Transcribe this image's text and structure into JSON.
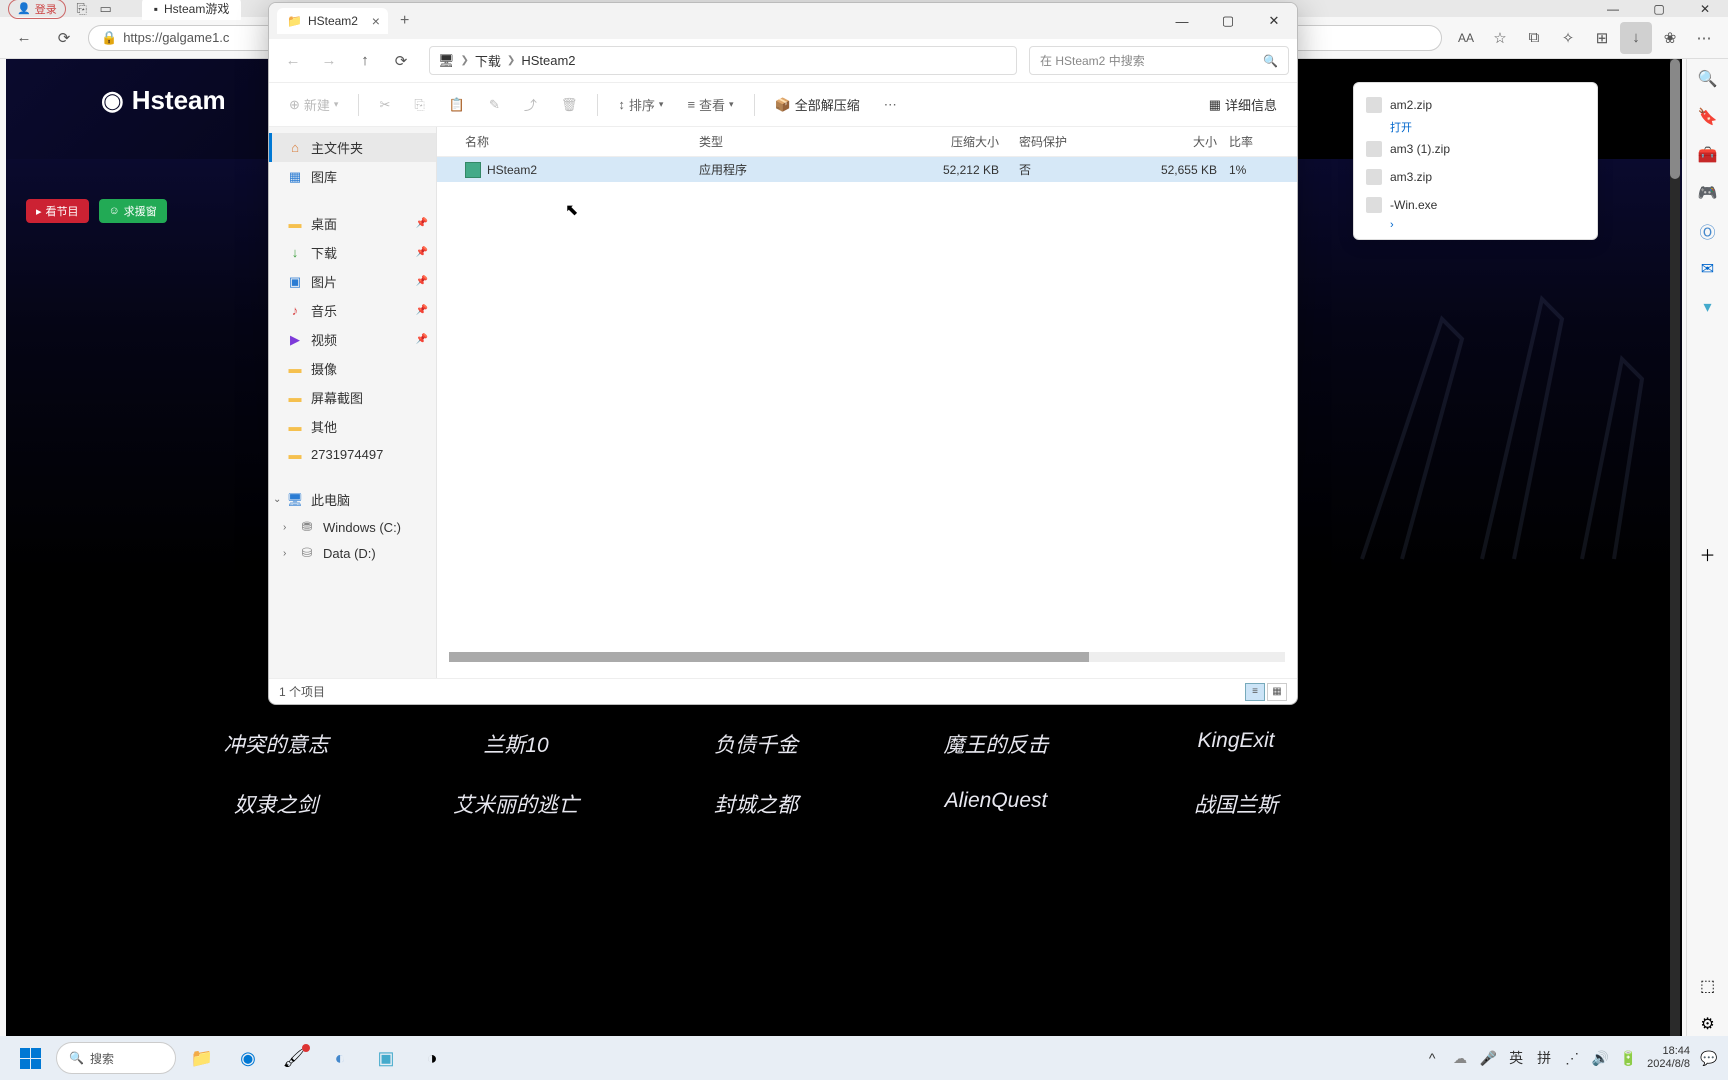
{
  "browser": {
    "login": "登录",
    "tab_title": "Hsteam游戏",
    "url": "https://galgame1.c",
    "win": {
      "min": "—",
      "max": "▢",
      "close": "✕"
    },
    "actions": {
      "read": "AA",
      "star": "☆",
      "collections": "⧉",
      "fav": "✧",
      "ext": "⊞",
      "dl": "↓",
      "shield": "❀",
      "more": "⋯"
    },
    "sec": {
      "folder": "🗀",
      "search": "🔍",
      "more": "⋯",
      "pin": "📌"
    }
  },
  "page": {
    "logo": "Hsteam",
    "nav1": "看节目",
    "nav2": "求援窗",
    "games": [
      "冲突的意志",
      "兰斯10",
      "负债千金",
      "魔王的反击",
      "KingExit",
      "奴隶之剑",
      "艾米丽的逃亡",
      "封城之都",
      "AlienQuest",
      "战国兰斯"
    ]
  },
  "downloads": {
    "items": [
      "am2.zip",
      "am3 (1).zip",
      "am3.zip",
      "-Win.exe"
    ]
  },
  "explorer": {
    "tab": "HSteam2",
    "breadcrumb": {
      "monitor": "🖥",
      "item1": "下载",
      "item2": "HSteam2"
    },
    "search_placeholder": "在 HSteam2 中搜索",
    "cmd": {
      "new": "新建",
      "sort": "排序",
      "view": "查看",
      "extract": "全部解压缩",
      "details": "详细信息"
    },
    "columns": {
      "name": "名称",
      "type": "类型",
      "csize": "压缩大小",
      "prot": "密码保护",
      "size": "大小",
      "ratio": "比率"
    },
    "file": {
      "name": "HSteam2",
      "type": "应用程序",
      "csize": "52,212 KB",
      "prot": "否",
      "size": "52,655 KB",
      "ratio": "1%"
    },
    "sidebar": {
      "home": "主文件夹",
      "gallery": "图库",
      "desktop": "桌面",
      "downloads": "下载",
      "pictures": "图片",
      "music": "音乐",
      "videos": "视频",
      "camera": "摄像",
      "screenshots": "屏幕截图",
      "other": "其他",
      "numfolder": "2731974497",
      "thispc": "此电脑",
      "drive_c": "Windows (C:)",
      "drive_d": "Data (D:)"
    },
    "status": "1 个项目"
  },
  "taskbar": {
    "search": "搜索",
    "tray": {
      "ime1": "英",
      "ime2": "拼",
      "time": "18:44",
      "date": "2024/8/8"
    }
  }
}
